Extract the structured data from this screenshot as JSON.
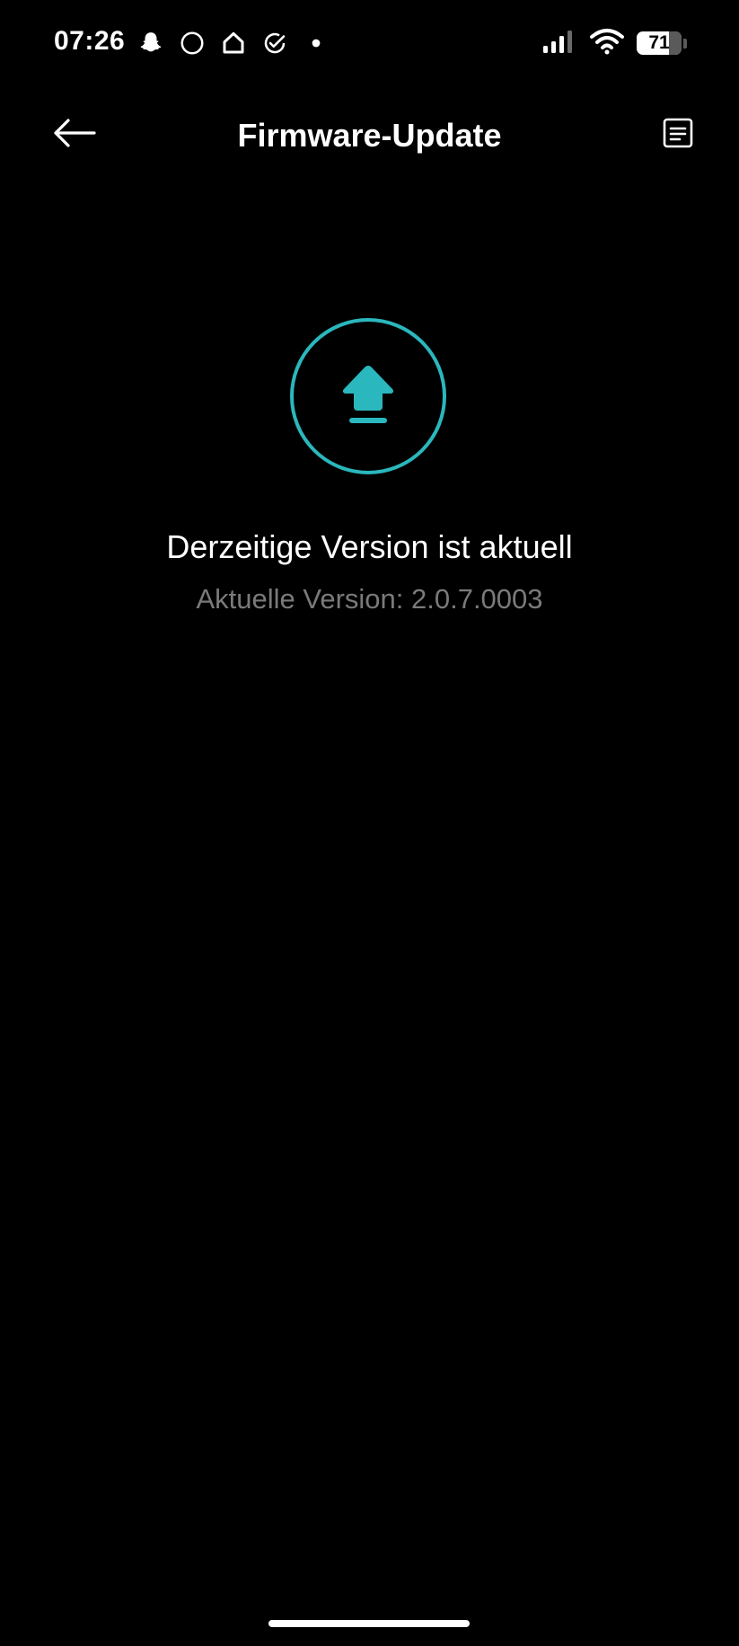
{
  "status_bar": {
    "time": "07:26",
    "notification_icons": [
      "snapchat-icon",
      "circle-icon",
      "home-icon",
      "check-circle-icon",
      "dot-icon"
    ],
    "signal_icon": "cellular-signal-icon",
    "wifi_icon": "wifi-icon",
    "battery_level": "71",
    "battery_fraction": 0.71
  },
  "app_bar": {
    "title": "Firmware-Update",
    "back_icon": "arrow-left-icon",
    "log_icon": "document-list-icon"
  },
  "content": {
    "graphic_icon": "upload-arrow-icon",
    "status_message": "Derzeitige Version ist aktuell",
    "version_text": "Aktuelle Version: 2.0.7.0003"
  },
  "colors": {
    "background": "#000000",
    "accent": "#2ab7bd",
    "primary_text": "#ffffff",
    "secondary_text": "#7a7a7a"
  }
}
